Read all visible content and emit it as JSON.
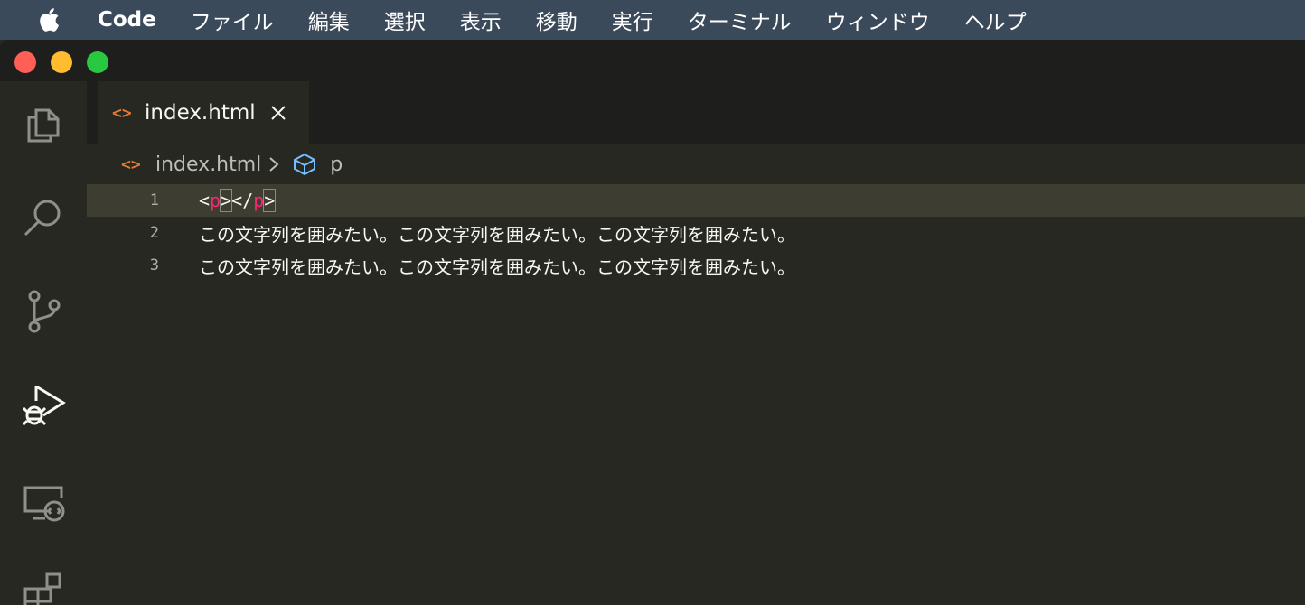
{
  "menubar": {
    "app_name": "Code",
    "items": [
      "ファイル",
      "編集",
      "選択",
      "表示",
      "移動",
      "実行",
      "ターミナル",
      "ウィンドウ",
      "ヘルプ"
    ]
  },
  "activity_icons": [
    "explorer-icon",
    "search-icon",
    "source-control-icon",
    "run-debug-icon",
    "remote-explorer-icon",
    "extensions-icon"
  ],
  "tab": {
    "label": "index.html",
    "icon": "<>"
  },
  "breadcrumb": {
    "icon": "<>",
    "file": "index.html",
    "element": "p"
  },
  "editor": {
    "lines": [
      {
        "number": "1",
        "open_lt": "<",
        "open_tag": "p",
        "open_gt": ">",
        "close_lt": "<",
        "close_slash": "/",
        "close_tag": "p",
        "close_gt": ">"
      },
      {
        "number": "2",
        "text": "この文字列を囲みたい。この文字列を囲みたい。この文字列を囲みたい。"
      },
      {
        "number": "3",
        "text": "この文字列を囲みたい。この文字列を囲みたい。この文字列を囲みたい。"
      }
    ]
  },
  "colors": {
    "menubar_bg": "#3b4a5a",
    "editor_bg": "#272822",
    "tag_color": "#f92672",
    "html_icon_color": "#e37933",
    "element_icon_color": "#75beff"
  }
}
